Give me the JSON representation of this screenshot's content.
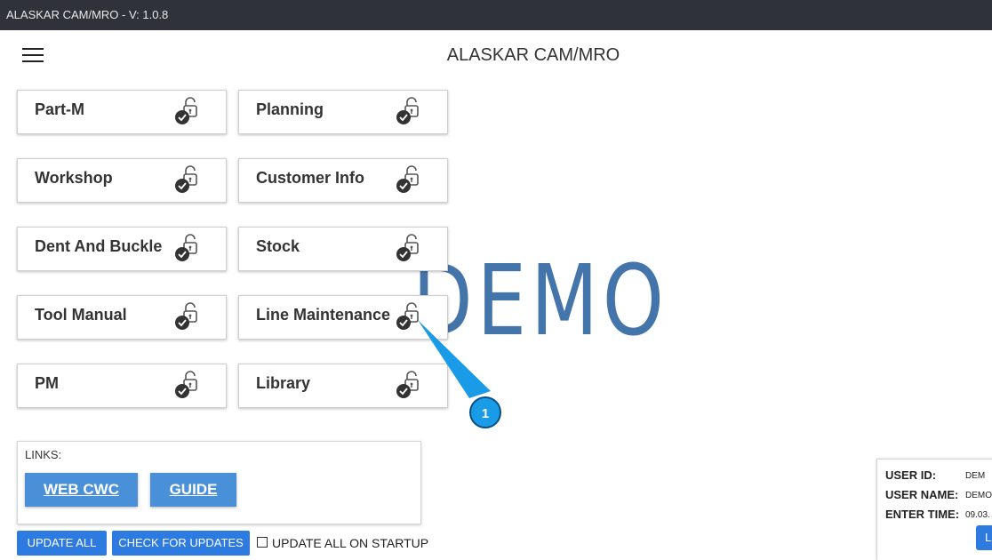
{
  "window": {
    "title": "ALASKAR CAM/MRO - V: 1.0.8"
  },
  "header": {
    "title": "ALASKAR CAM/MRO",
    "menu_icon": "hamburger-menu-icon"
  },
  "watermark": "DEMO",
  "modules": [
    {
      "label": "Part-M"
    },
    {
      "label": "Planning"
    },
    {
      "label": "Workshop"
    },
    {
      "label": "Customer Info"
    },
    {
      "label": "Dent And Buckle"
    },
    {
      "label": "Stock"
    },
    {
      "label": "Tool Manual"
    },
    {
      "label": "Line Maintenance"
    },
    {
      "label": "PM"
    },
    {
      "label": "Library"
    }
  ],
  "callout": {
    "number": "1",
    "color": "#1a9be8"
  },
  "links": {
    "header": "LINKS:",
    "items": [
      {
        "label": "WEB CWC"
      },
      {
        "label": "GUIDE"
      }
    ]
  },
  "actions": {
    "update_all": "UPDATE ALL",
    "check_updates": "CHECK FOR UPDATES",
    "startup_label": "UPDATE ALL ON STARTUP",
    "startup_checked": false
  },
  "user": {
    "id_label": "USER ID:",
    "id_value": "DEM",
    "name_label": "USER NAME:",
    "name_value": "DEMO",
    "time_label": "ENTER TIME:",
    "time_value": "09.03.",
    "button_partial": "L"
  },
  "colors": {
    "titlebar": "#2f3238",
    "accent": "#2d7be0",
    "link_button": "#4a90d9",
    "watermark": "#3b6ea6"
  }
}
